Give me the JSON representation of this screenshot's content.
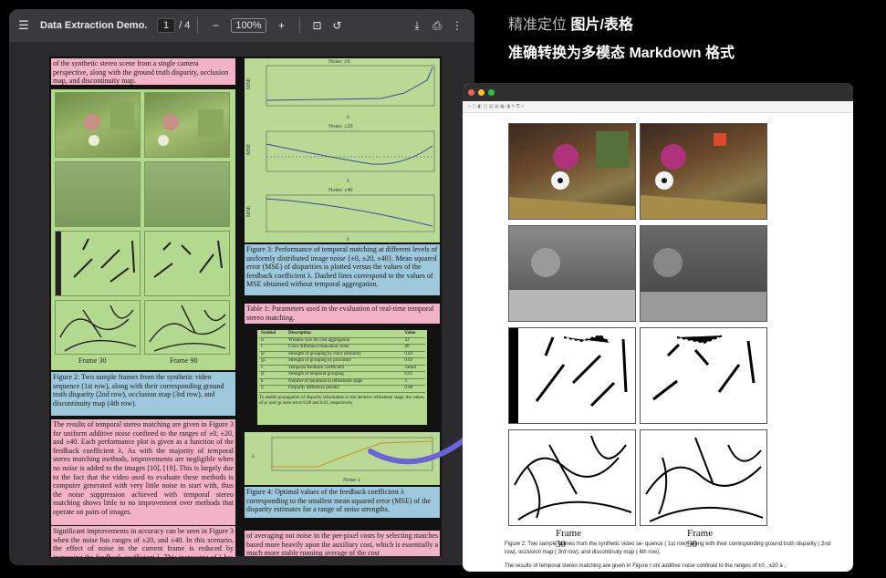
{
  "viewer": {
    "file_name": "Data Extraction Demo.pdf",
    "page_current": "1",
    "page_total": "/ 4",
    "zoom": "100%"
  },
  "pdf": {
    "para_top": "of the synthetic stereo scene from a single camera perspective, along with the ground truth disparity, occlusion map, and discontinuity map.",
    "frame30": "Frame 30",
    "frame90": "Frame 90",
    "fig2_caption": "Figure 2: Two sample frames from the synthetic video sequence (1st row), along with their corresponding ground truth disparity (2nd row), occlusion map (3rd row), and discontinuity map (4th row).",
    "body1": "The results of temporal stereo matching are given in Figure 3 for uniform additive noise confined to the ranges of ±0, ±20, and ±40. Each performance plot is given as a function of the feedback coefficient λ. As with the majority of temporal stereo matching methods, improvements are negligible when no noise is added to the images [10], [19]. This is largely due to the fact that the video used to evaluate these methods is computer generated with very little noise to start with, thus the noise suppression achieved with temporal stereo matching shows little to no improvement over methods that operate on pairs of images.",
    "body2": "Significant improvements in accuracy can be seen in Figure 3 when the noise has ranges of ±20, and ±40. In this scenario, the effect of noise in the current frame is reduced by increasing the feedback coefficient λ. This increasing of λ has the effect",
    "noise0": "Noise: ±0",
    "noise20": "Noise: ±20",
    "noise40": "Noise: ±40",
    "mse": "MSE",
    "lambda": "λ",
    "noise_axis": "Noise ±",
    "fig3_caption": "Figure 3: Performance of temporal matching at different levels of uniformly distributed image noise {±0, ±20, ±40}. Mean squared error (MSE) of disparities is plotted versus the values of the feedback coefficient λ. Dashed lines correspond to the values of MSE obtained without temporal aggregation.",
    "table1_caption": "Table 1: Parameters used in the evaluation of real-time temporal stereo matching.",
    "table_head": [
      "Symbol",
      "Description",
      "Value"
    ],
    "table_rows": [
      [
        "ω",
        "Window size for cost aggregation",
        "33"
      ],
      [
        "τ",
        "Color difference truncation value",
        "40"
      ],
      [
        "γc",
        "Strength of grouping by color similarity",
        "0.03"
      ],
      [
        "γp",
        "Strength of grouping by proximity",
        "0.03"
      ],
      [
        "λ",
        "Temporal feedback coefficient",
        "varied"
      ],
      [
        "γt",
        "Strength of temporal grouping",
        "0.01"
      ],
      [
        "δ",
        "Number of iterations in refinement stage",
        "3"
      ],
      [
        "α",
        "Disparity difference penalty",
        "0.08"
      ]
    ],
    "table_note": "To enable propagation of disparity information in the iterative refinement stage, the values of γc and γp were set to 0.08 and 0.01, respectively.",
    "fig4_caption": "Figure 4: Optimal values of the feedback coefficient λ corresponding to the smallest mean squared error (MSE) of the disparity estimates for a range of noise strengths.",
    "bottom_text": "of averaging out noise in the per-pixel costs by selecting matches based more heavily upon the auxiliary cost, which is essentially a much more stable running average of the cost"
  },
  "right": {
    "title_prefix": "精准定位 ",
    "title_bold": "图片/表格",
    "subtitle": "准确转换为多模态 Markdown 格式",
    "frame30": "Frame 30",
    "frame90": "Frame 90",
    "caption": "Figure 2: Two sample frames from the synthetic video se- quence ( 1st row), along with their corresponding ground truth disparity ( 2nd row), occlusion map ( 3rd row), and discontinuity map ( 4th row).",
    "body": "The results of temporal stereo matching are given in Figure r uni additive noise confined to the ranges of ±0 , ±20 a ,"
  },
  "colors": {
    "pink": "#f3b3c7",
    "green": "#b3d98f",
    "blue": "#9ec8dc",
    "arrow": "#6b63d8"
  }
}
